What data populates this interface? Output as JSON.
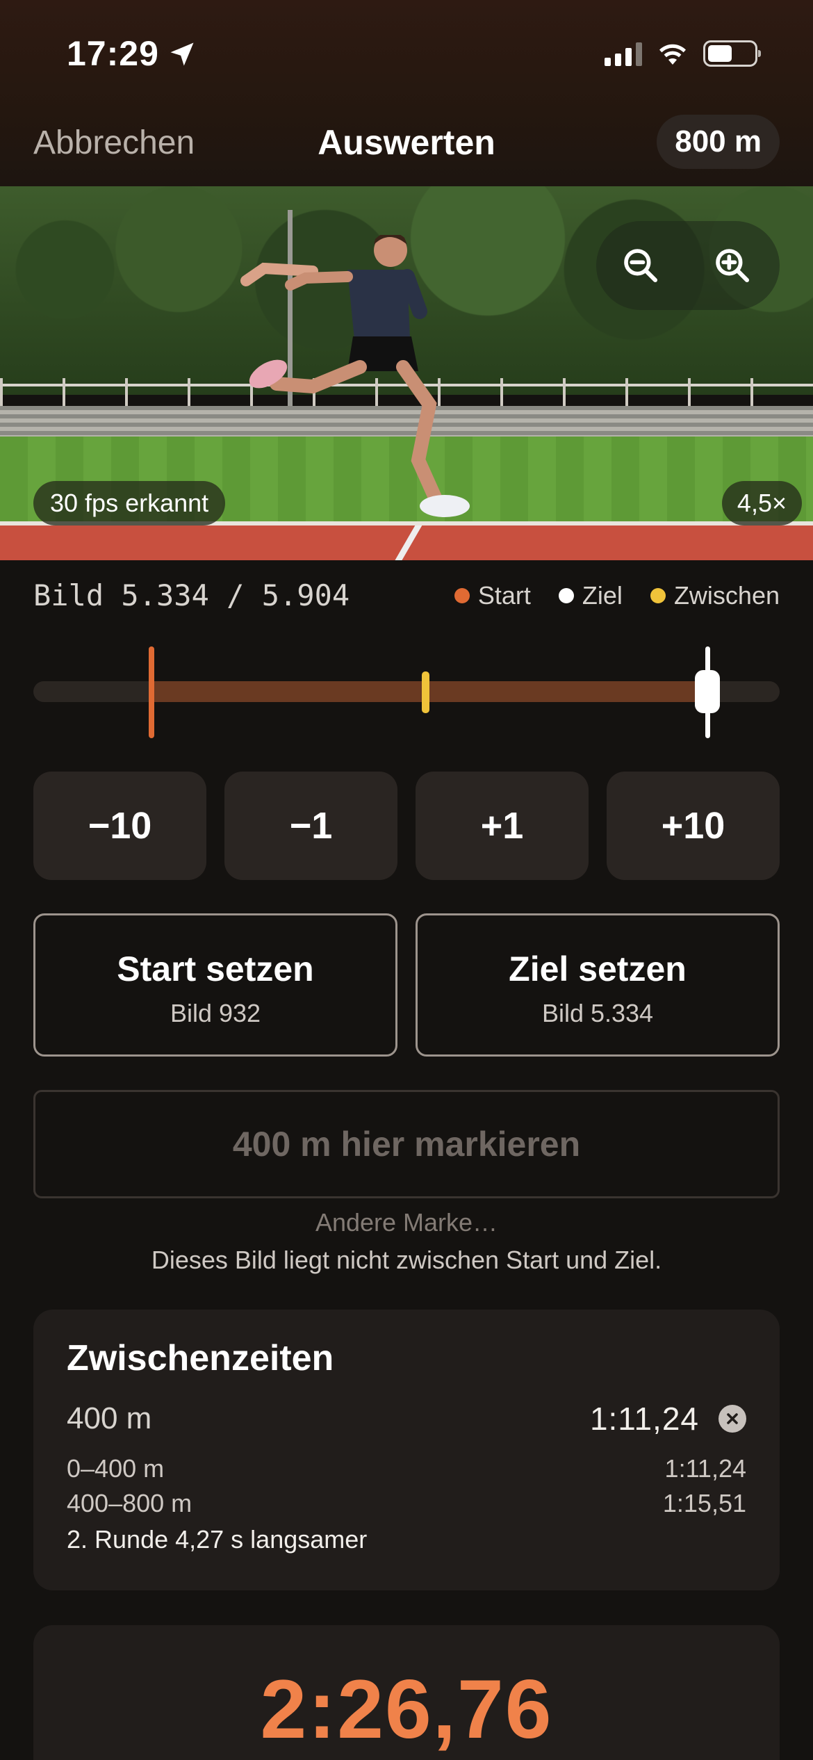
{
  "status_bar": {
    "time": "17:29"
  },
  "nav": {
    "cancel_label": "Abbrechen",
    "title": "Auswerten",
    "distance": "800 m"
  },
  "video": {
    "fps_badge": "30 fps erkannt",
    "zoom_badge": "4,5×"
  },
  "frame": {
    "counter": "Bild 5.334 / 5.904",
    "current": 5334,
    "total": 5904,
    "start": 932,
    "split": 3100
  },
  "legend": [
    {
      "label": "Start",
      "color": "#e06a33"
    },
    {
      "label": "Ziel",
      "color": "#ffffff"
    },
    {
      "label": "Zwischen",
      "color": "#f0c33a"
    }
  ],
  "steps": [
    "−10",
    "−1",
    "+1",
    "+10"
  ],
  "set_start": {
    "title": "Start setzen",
    "sub": "Bild 932"
  },
  "set_finish": {
    "title": "Ziel setzen",
    "sub": "Bild 5.334"
  },
  "mark": {
    "button": "400 m hier markieren",
    "other": "Andere Marke…",
    "hint": "Dieses Bild liegt nicht zwischen Start und Ziel."
  },
  "splits": {
    "title": "Zwischenzeiten",
    "main_label": "400 m",
    "main_time": "1:11,24",
    "segments": [
      {
        "label": "0–400 m",
        "time": "1:11,24"
      },
      {
        "label": "400–800 m",
        "time": "1:15,51"
      }
    ],
    "note": "2. Runde 4,27 s langsamer"
  },
  "total": {
    "time": "2:26,76"
  }
}
